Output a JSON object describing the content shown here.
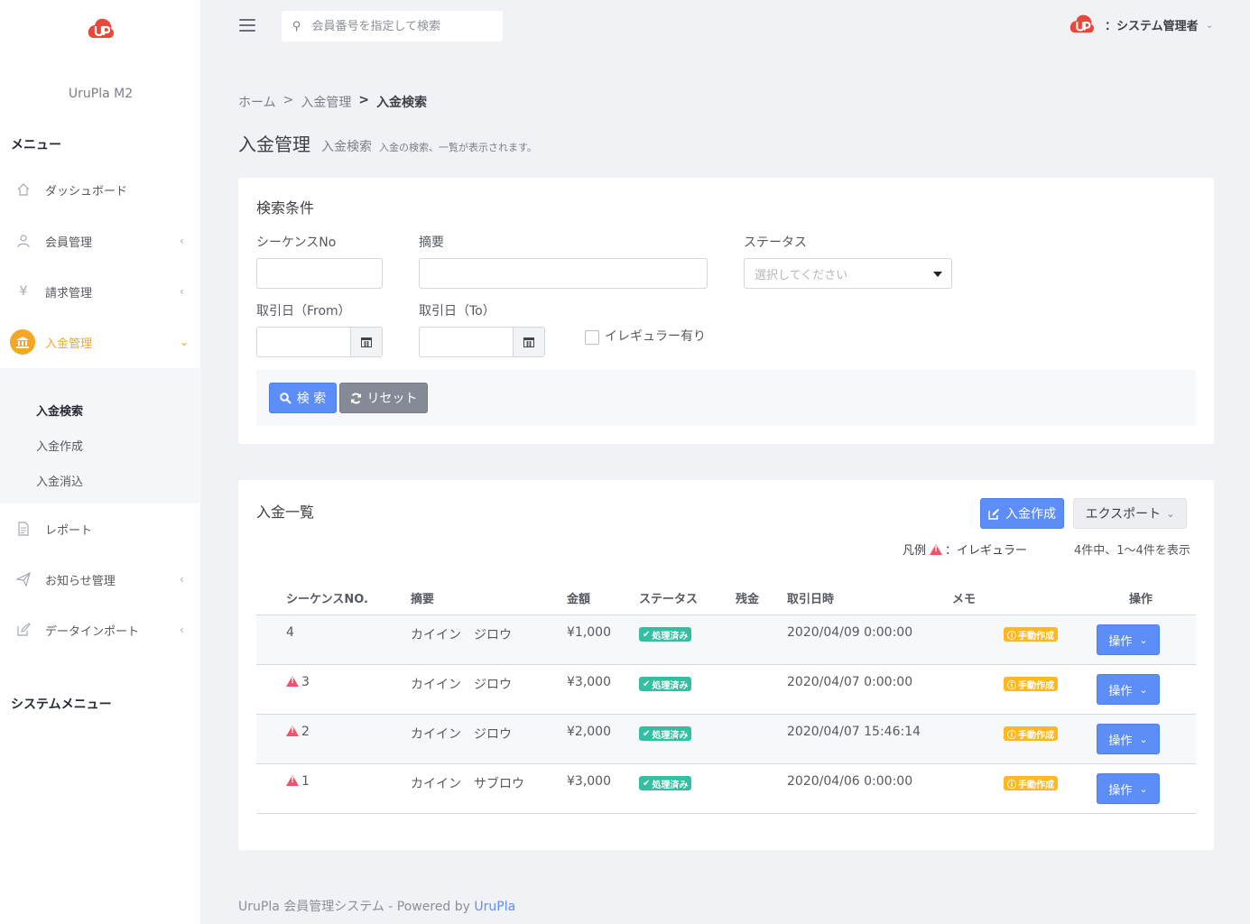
{
  "app": {
    "brand": "UruPla M2"
  },
  "sidebar": {
    "menu_heading": "メニュー",
    "items": [
      {
        "label": "ダッシュボード"
      },
      {
        "label": "会員管理"
      },
      {
        "label": "請求管理"
      },
      {
        "label": "入金管理"
      },
      {
        "label": "レポート"
      },
      {
        "label": "お知らせ管理"
      },
      {
        "label": "データインポート"
      }
    ],
    "subitems": [
      {
        "label": "入金検索"
      },
      {
        "label": "入金作成"
      },
      {
        "label": "入金消込"
      }
    ],
    "system_heading": "システムメニュー"
  },
  "topbar": {
    "search_placeholder": "会員番号を指定して検索",
    "user_label": "：システム管理者"
  },
  "breadcrumb": {
    "home": "ホーム",
    "sep1": ">",
    "section": "入金管理",
    "sep2": ">",
    "current": "入金検索"
  },
  "page": {
    "title": "入金管理",
    "subtitle": "入金検索",
    "description": "入金の検索、一覧が表示されます。"
  },
  "search_form": {
    "title": "検索条件",
    "sequence_label": "シーケンスNo",
    "summary_label": "摘要",
    "status_label": "ステータス",
    "status_placeholder": "選択してください",
    "date_from_label": "取引日（From）",
    "date_to_label": "取引日（To）",
    "irregular_label": "イレギュラー有り",
    "search_button": "検 索",
    "reset_button": "リセット"
  },
  "list": {
    "title": "入金一覧",
    "create_button": "入金作成",
    "export_button": "エクスポート",
    "legend_label": "凡例",
    "legend_text": "：イレギュラー",
    "count_text": "4件中、1〜4件を表示",
    "columns": {
      "sequence": "シーケンスNO.",
      "summary": "摘要",
      "amount": "金額",
      "status": "ステータス",
      "balance": "残金",
      "date": "取引日時",
      "memo": "メモ",
      "action": "操作"
    },
    "rows": [
      {
        "seq": "4",
        "summary": "カイイン　ジロウ",
        "amount": "¥1,000",
        "status": "処理済み",
        "balance": "",
        "date": "2020/04/09 0:00:00",
        "memo": "手動作成",
        "action": "操作"
      },
      {
        "seq": "3",
        "summary": "カイイン　ジロウ",
        "amount": "¥3,000",
        "status": "処理済み",
        "balance": "",
        "date": "2020/04/07 0:00:00",
        "memo": "手動作成",
        "action": "操作"
      },
      {
        "seq": "2",
        "summary": "カイイン　ジロウ",
        "amount": "¥2,000",
        "status": "処理済み",
        "balance": "",
        "date": "2020/04/07 15:46:14",
        "memo": "手動作成",
        "action": "操作"
      },
      {
        "seq": "1",
        "summary": "カイイン　サブロウ",
        "amount": "¥3,000",
        "status": "処理済み",
        "balance": "",
        "date": "2020/04/06 0:00:00",
        "memo": "手動作成",
        "action": "操作"
      }
    ]
  },
  "footer": {
    "text": "UruPla 会員管理システム - Powered by ",
    "link": "UruPla"
  },
  "colors": {
    "accent": "#f5a623",
    "primary": "#5d8ef7",
    "success": "#34bfa3",
    "warning": "#ffb822",
    "danger": "#f4516c"
  }
}
